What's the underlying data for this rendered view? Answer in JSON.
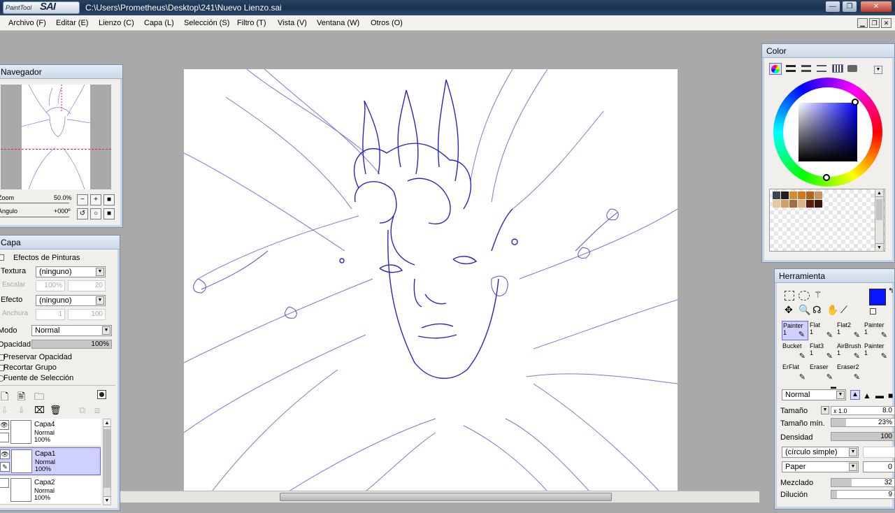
{
  "titlebar": {
    "logo_small": "PaintTool",
    "logo_big": "SAI",
    "file_path": "C:\\Users\\Prometheus\\Desktop\\241\\Nuevo Lienzo.sai",
    "minimize_glyph": "—",
    "maximize_glyph": "❐",
    "close_glyph": "✕"
  },
  "menubar": {
    "items": [
      "Archivo (F)",
      "Editar (E)",
      "Lienzo (C)",
      "Capa (L)",
      "Selección (S)",
      "Filtro (T)",
      "Vista (V)",
      "Ventana (W)",
      "Otros (O)"
    ]
  },
  "navigator": {
    "title": "Navegador",
    "zoom_label": "Zoom",
    "zoom_value": "50.0%",
    "angle_label": "Angulo",
    "angle_value": "+000º"
  },
  "layer_panel": {
    "title": "Capa",
    "paint_effects_label": "Efectos de Pinturas",
    "texture_label": "Textura",
    "texture_value": "(ninguno)",
    "scale_label": "Escalar",
    "scale_value": "100%",
    "scale_num": "20",
    "effect_label": "Efecto",
    "effect_value": "(ninguno)",
    "width_label": "Anchura",
    "width_value": "1",
    "width_num": "100",
    "mode_label": "Modo",
    "mode_value": "Normal",
    "opacity_label": "Opacidad",
    "opacity_value": "100%",
    "opacity_fraction": 1.0,
    "preserve_opacity": "Preservar Opacidad",
    "clip_group": "Recortar Grupo",
    "selection_source": "Fuente de Selección",
    "layers": [
      {
        "name": "Capa4",
        "mode": "Normal",
        "opacity": "100%",
        "selected": false
      },
      {
        "name": "Capa1",
        "mode": "Normal",
        "opacity": "100%",
        "selected": true
      },
      {
        "name": "Capa2",
        "mode": "Normal",
        "opacity": "100%",
        "selected": false
      }
    ]
  },
  "color_panel": {
    "title": "Color",
    "current_color": "#0a14ff",
    "swatches": [
      "#3c4650",
      "#1e1e1e",
      "#d28c32",
      "#d2781e",
      "#b46414",
      "#c89664",
      "#e6c8a0",
      "#d2a064",
      "#a06e46",
      "#dcb48c",
      "#5a1e0a",
      "#3c140a"
    ]
  },
  "tool_panel": {
    "title": "Herramienta",
    "foreground_color": "#0a14ff",
    "tools": [
      {
        "name": "Painter",
        "size": "1"
      },
      {
        "name": "Flat",
        "size": "1"
      },
      {
        "name": "Flat2",
        "size": "1"
      },
      {
        "name": "Painter",
        "size": "1"
      },
      {
        "name": "Bucket",
        "size": ""
      },
      {
        "name": "Flat3",
        "size": "1"
      },
      {
        "name": "AirBrush",
        "size": "1"
      },
      {
        "name": "Painter",
        "size": "1"
      },
      {
        "name": "ErFlat",
        "size": ""
      },
      {
        "name": "Eraser",
        "size": ""
      },
      {
        "name": "Eraser2",
        "size": ""
      }
    ],
    "blend_mode": "Normal",
    "size_label": "Tamaño",
    "size_multiplier": "x 1.0",
    "size_value": "8.0",
    "min_size_label": "Tamaño mín.",
    "min_size_value": "23%",
    "min_size_fraction": 0.23,
    "density_label": "Densidad",
    "density_value": "100",
    "density_fraction": 1.0,
    "shape_value": "(círculo simple)",
    "texture_value": "Paper",
    "texture_num": "0",
    "blending_label": "Mezclado",
    "blending_value": "32",
    "blending_fraction": 0.32,
    "dilution_label": "Dilución",
    "dilution_value": "9",
    "dilution_fraction": 0.09
  }
}
